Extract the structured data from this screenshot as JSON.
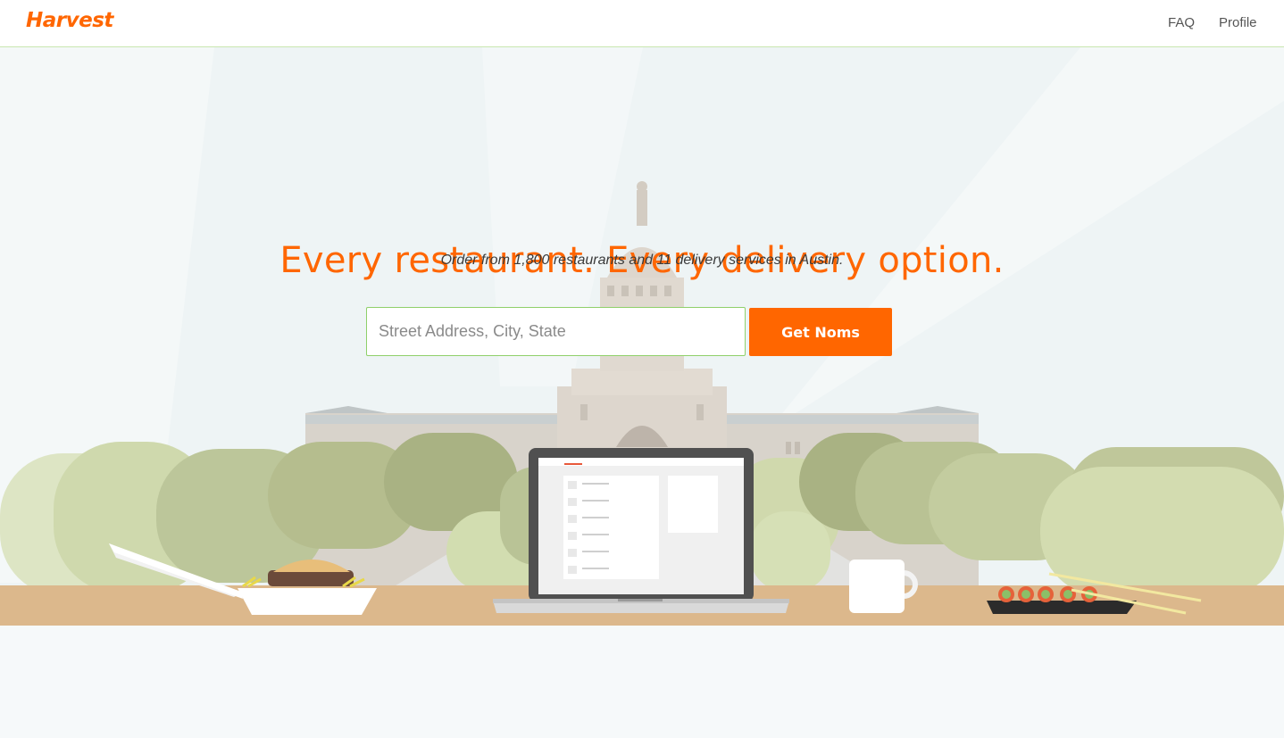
{
  "header": {
    "logo": "Harvest",
    "nav": {
      "faq": "FAQ",
      "profile": "Profile"
    }
  },
  "hero": {
    "headline": "Every restaurant. Every delivery option.",
    "subline": "Order from 1,800 restaurants and 11 delivery services in Austin.",
    "address_placeholder": "Street Address, City, State",
    "address_value": "",
    "submit_label": "Get Noms"
  },
  "colors": {
    "brand": "#ff6600",
    "input_border": "#8fd06a",
    "table": "#dcb88c",
    "sky": "#eef4f5"
  }
}
